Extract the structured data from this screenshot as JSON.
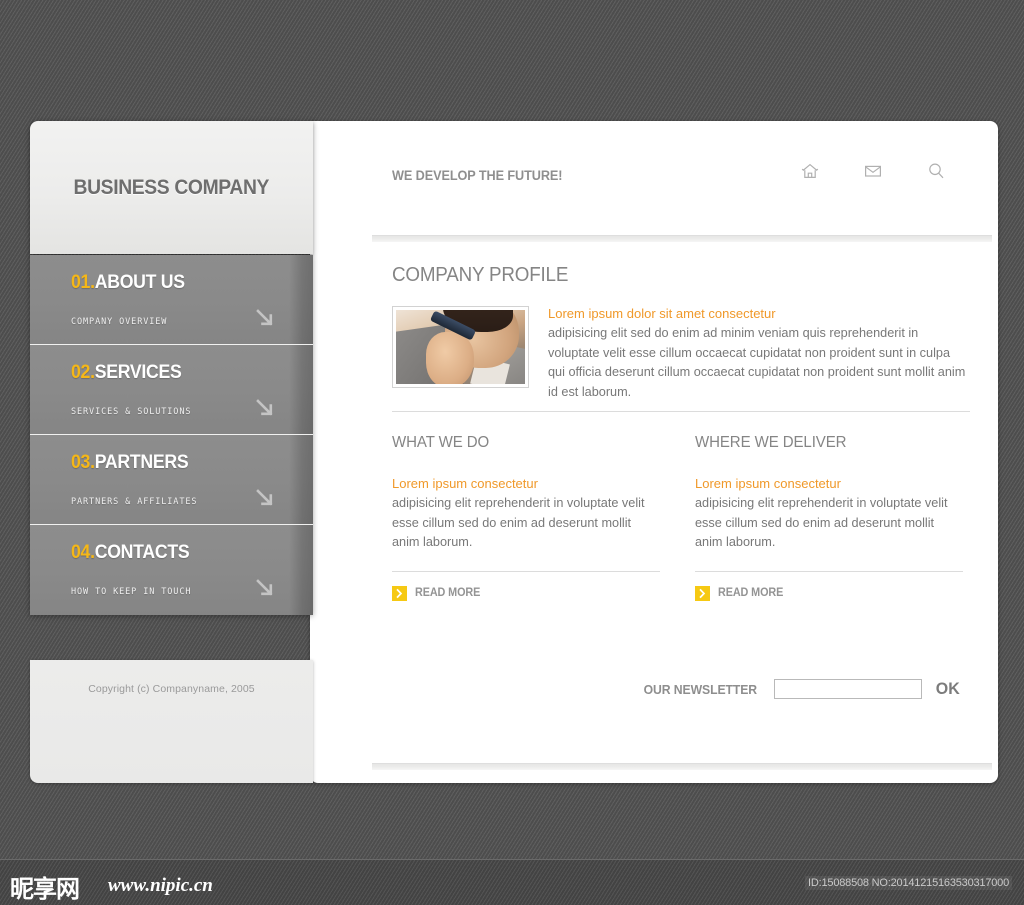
{
  "site": {
    "logo": "BUSINESS COMPANY",
    "tagline": "WE DEVELOP THE FUTURE!",
    "copyright": "Copyright (c) Companyname, 2005"
  },
  "header": {
    "icons": [
      {
        "name": "home-icon",
        "title": "Home"
      },
      {
        "name": "mail-icon",
        "title": "Mail"
      },
      {
        "name": "search-icon",
        "title": "Search"
      }
    ]
  },
  "sidebar": {
    "items": [
      {
        "number": "01.",
        "label": "ABOUT US",
        "subtitle": "COMPANY OVERVIEW"
      },
      {
        "number": "02.",
        "label": "SERVICES",
        "subtitle": "SERVICES & SOLUTIONS"
      },
      {
        "number": "03.",
        "label": "PARTNERS",
        "subtitle": "PARTNERS & AFFILIATES"
      },
      {
        "number": "04.",
        "label": "CONTACTS",
        "subtitle": "HOW TO KEEP IN TOUCH"
      }
    ]
  },
  "main": {
    "profile": {
      "title": "COMPANY PROFILE",
      "photo_alt": "businessman talking on mobile phone",
      "lede": "Lorem ipsum dolor sit amet consectetur",
      "body": "adipisicing elit sed do enim ad minim veniam quis  reprehenderit in voluptate velit esse cillum occaecat cupidatat non proident sunt in culpa qui officia deserunt cillum occaecat cupidatat non proident sunt mollit anim id est laborum."
    },
    "columns": [
      {
        "title": "WHAT WE DO",
        "lede": "Lorem ipsum consectetur",
        "body": "adipisicing elit reprehenderit in voluptate velit esse cillum sed do enim ad deserunt mollit anim laborum.",
        "read_more": "READ MORE"
      },
      {
        "title": "WHERE WE DELIVER",
        "lede": "Lorem ipsum consectetur",
        "body": "adipisicing elit reprehenderit in voluptate velit esse cillum sed do enim ad deserunt mollit anim laborum.",
        "read_more": "READ MORE"
      }
    ],
    "newsletter": {
      "label": "OUR NEWSLETTER",
      "value": "",
      "placeholder": "",
      "submit": "OK"
    }
  },
  "watermark": {
    "cn_logo": "昵享网",
    "url": "www.nipic.cn",
    "id_text": "ID:15088508 NO:20141215163530317000"
  },
  "colors": {
    "accent_yellow": "#f5b717",
    "accent_orange": "#f0992a",
    "nav_gray": "#8a8a8a",
    "text_gray": "#787878",
    "page_bg": "#565656"
  }
}
